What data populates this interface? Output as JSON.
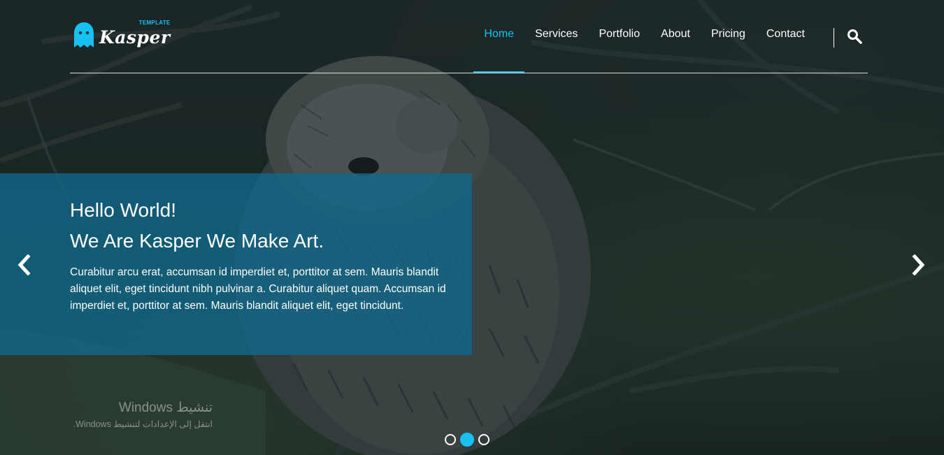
{
  "brand": {
    "name": "Kasper",
    "tag": "TEMPLATE",
    "accent_color": "#19c1f1"
  },
  "nav": {
    "items": [
      {
        "label": "Home",
        "active": true
      },
      {
        "label": "Services",
        "active": false
      },
      {
        "label": "Portfolio",
        "active": false
      },
      {
        "label": "About",
        "active": false
      },
      {
        "label": "Pricing",
        "active": false
      },
      {
        "label": "Contact",
        "active": false
      }
    ],
    "search_icon": "search-icon"
  },
  "hero": {
    "greeting": "Hello World!",
    "tagline": "We Are Kasper We Make Art.",
    "description": "Curabitur arcu erat, accumsan id imperdiet et, porttitor at sem. Mauris blandit aliquet elit, eget tincidunt nibh pulvinar a. Curabitur aliquet quam. Accumsan id imperdiet et, porttitor at sem. Mauris blandit aliquet elit, eget tincidunt.",
    "box_color": "#0f698c",
    "prev_icon": "chevron-left-icon",
    "next_icon": "chevron-right-icon"
  },
  "slider": {
    "total": 3,
    "active_index": 1
  },
  "watermark": {
    "title": "تنشيط Windows",
    "subtitle": "انتقل إلى الإعدادات لتنشيط Windows."
  }
}
